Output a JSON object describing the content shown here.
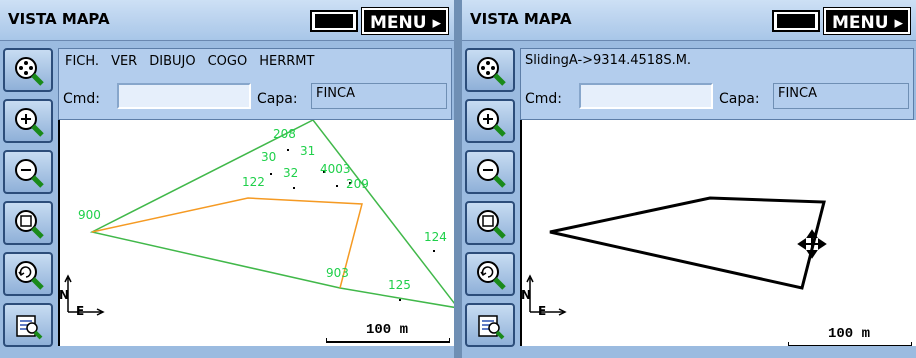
{
  "left": {
    "title": "VISTA MAPA",
    "menu_label": "MENU",
    "menubar": [
      "FICH.",
      "VER",
      "DIBUJO",
      "COGO",
      "HERRMT"
    ],
    "cmd_label": "Cmd:",
    "capa_label": "Capa:",
    "capa_value": "FINCA",
    "points": [
      {
        "id": "208"
      },
      {
        "id": "30"
      },
      {
        "id": "31"
      },
      {
        "id": "32"
      },
      {
        "id": "4003"
      },
      {
        "id": "122"
      },
      {
        "id": "209"
      },
      {
        "id": "900"
      },
      {
        "id": "124"
      },
      {
        "id": "903"
      },
      {
        "id": "125"
      }
    ],
    "north_label": "N",
    "east_label": "E",
    "scale_text": "100 m"
  },
  "right": {
    "title": "VISTA MAPA",
    "menu_label": "MENU",
    "status_text": "SlidingA->9314.4518S.M.",
    "cmd_label": "Cmd:",
    "capa_label": "Capa:",
    "capa_value": "FINCA",
    "north_label": "N",
    "east_label": "E",
    "scale_text": "100 m"
  },
  "tools": [
    "zoom-extents-icon",
    "zoom-in-icon",
    "zoom-out-icon",
    "zoom-window-icon",
    "zoom-previous-icon",
    "layers-icon"
  ],
  "colors": {
    "line_green": "#41b84a",
    "line_orange": "#f59a23",
    "label_green": "#1fd04a",
    "line_black": "#000000"
  }
}
